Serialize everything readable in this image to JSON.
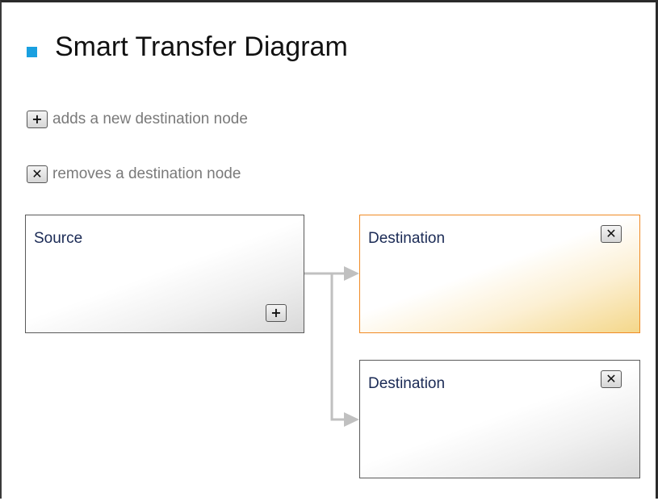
{
  "header": {
    "title": "Smart Transfer Diagram",
    "bullet_color": "#1aa0e0"
  },
  "legend": [
    {
      "icon": "plus-icon",
      "glyph": "+",
      "text": "adds a new destination node"
    },
    {
      "icon": "close-icon",
      "glyph": "✕",
      "text": "removes a destination node"
    }
  ],
  "diagram": {
    "source": {
      "label": "Source",
      "add_glyph": "+",
      "add_icon": "plus-icon"
    },
    "destinations": [
      {
        "label": "Destination",
        "remove_glyph": "✕",
        "remove_icon": "close-icon",
        "highlighted": true
      },
      {
        "label": "Destination",
        "remove_glyph": "✕",
        "remove_icon": "close-icon",
        "highlighted": false
      }
    ],
    "highlight_color": "#f08a24",
    "connector_color": "#c0c0c0"
  }
}
